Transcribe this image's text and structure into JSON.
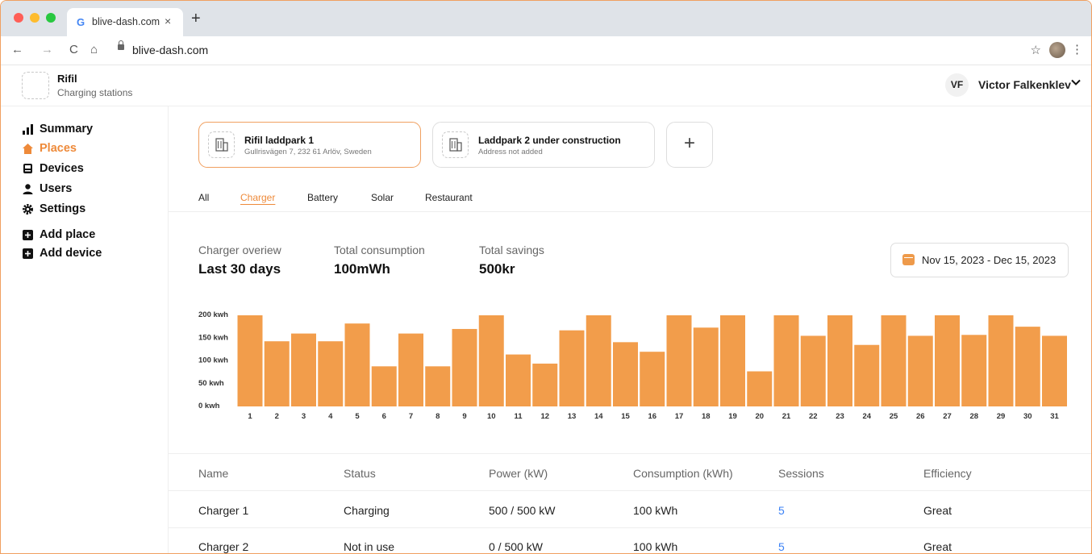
{
  "browser": {
    "tab_title": "blive-dash.com",
    "tab_close": "×",
    "new_tab": "+",
    "url": "blive-dash.com",
    "nav": {
      "back": "←",
      "forward": "→",
      "reload": "C",
      "home": "⌂"
    },
    "star": "☆",
    "menu": "⋮"
  },
  "app": {
    "brand": "Rifil",
    "brand_sub": "Charging stations",
    "user_initials": "VF",
    "user_name": "Victor Falkenklev"
  },
  "sidebar": {
    "items": [
      {
        "label": "Summary",
        "icon": "bar-chart-icon"
      },
      {
        "label": "Places",
        "icon": "home-icon",
        "active": true
      },
      {
        "label": "Devices",
        "icon": "device-icon"
      },
      {
        "label": "Users",
        "icon": "user-icon"
      },
      {
        "label": "Settings",
        "icon": "gear-icon"
      },
      {
        "label": "Add place",
        "icon": "plus-square-icon"
      },
      {
        "label": "Add device",
        "icon": "plus-square-icon"
      }
    ]
  },
  "places": [
    {
      "title": "Rifil laddpark 1",
      "address": "Gullrisvägen 7, 232 61 Arlöv, Sweden",
      "selected": true
    },
    {
      "title": "Laddpark 2 under construction",
      "address": "Address not added",
      "selected": false
    }
  ],
  "add_place_symbol": "+",
  "filters": [
    "All",
    "Charger",
    "Battery",
    "Solar",
    "Restaurant"
  ],
  "active_filter": "Charger",
  "stats": [
    {
      "label": "Charger overiew",
      "value": "Last 30 days"
    },
    {
      "label": "Total consumption",
      "value": "100mWh"
    },
    {
      "label": "Total savings",
      "value": "500kr"
    }
  ],
  "date_range": "Nov 15, 2023 - Dec 15, 2023",
  "colors": {
    "accent": "#ee8a3a",
    "bar": "#f29d4b",
    "link": "#3b82f6"
  },
  "chart_data": {
    "type": "bar",
    "categories": [
      "1",
      "2",
      "3",
      "4",
      "5",
      "6",
      "7",
      "8",
      "9",
      "10",
      "11",
      "12",
      "13",
      "14",
      "15",
      "16",
      "17",
      "18",
      "19",
      "20",
      "21",
      "22",
      "23",
      "24",
      "25",
      "26",
      "27",
      "28",
      "29",
      "30",
      "31"
    ],
    "values": [
      200,
      143,
      160,
      143,
      182,
      88,
      160,
      88,
      170,
      200,
      114,
      94,
      167,
      200,
      141,
      120,
      200,
      173,
      200,
      77,
      200,
      155,
      200,
      135,
      200,
      155,
      200,
      157,
      200,
      175,
      155
    ],
    "ylim": [
      0,
      200
    ],
    "yticks": [
      {
        "value": 200,
        "label": "200 kwh"
      },
      {
        "value": 150,
        "label": "150 kwh"
      },
      {
        "value": 100,
        "label": "100 kwh"
      },
      {
        "value": 50,
        "label": "50 kwh"
      },
      {
        "value": 0,
        "label": "0 kwh"
      }
    ],
    "grid": false,
    "title": "",
    "xlabel": "",
    "ylabel": ""
  },
  "table": {
    "headers": [
      "Name",
      "Status",
      "Power (kW)",
      "Consumption (kWh)",
      "Sessions",
      "Efficiency"
    ],
    "rows": [
      [
        "Charger 1",
        "Charging",
        "500 / 500 kW",
        "100 kWh",
        "5",
        "Great"
      ],
      [
        "Charger 2",
        "Not in use",
        "0 / 500 kW",
        "100 kWh",
        "5",
        "Great"
      ]
    ]
  }
}
